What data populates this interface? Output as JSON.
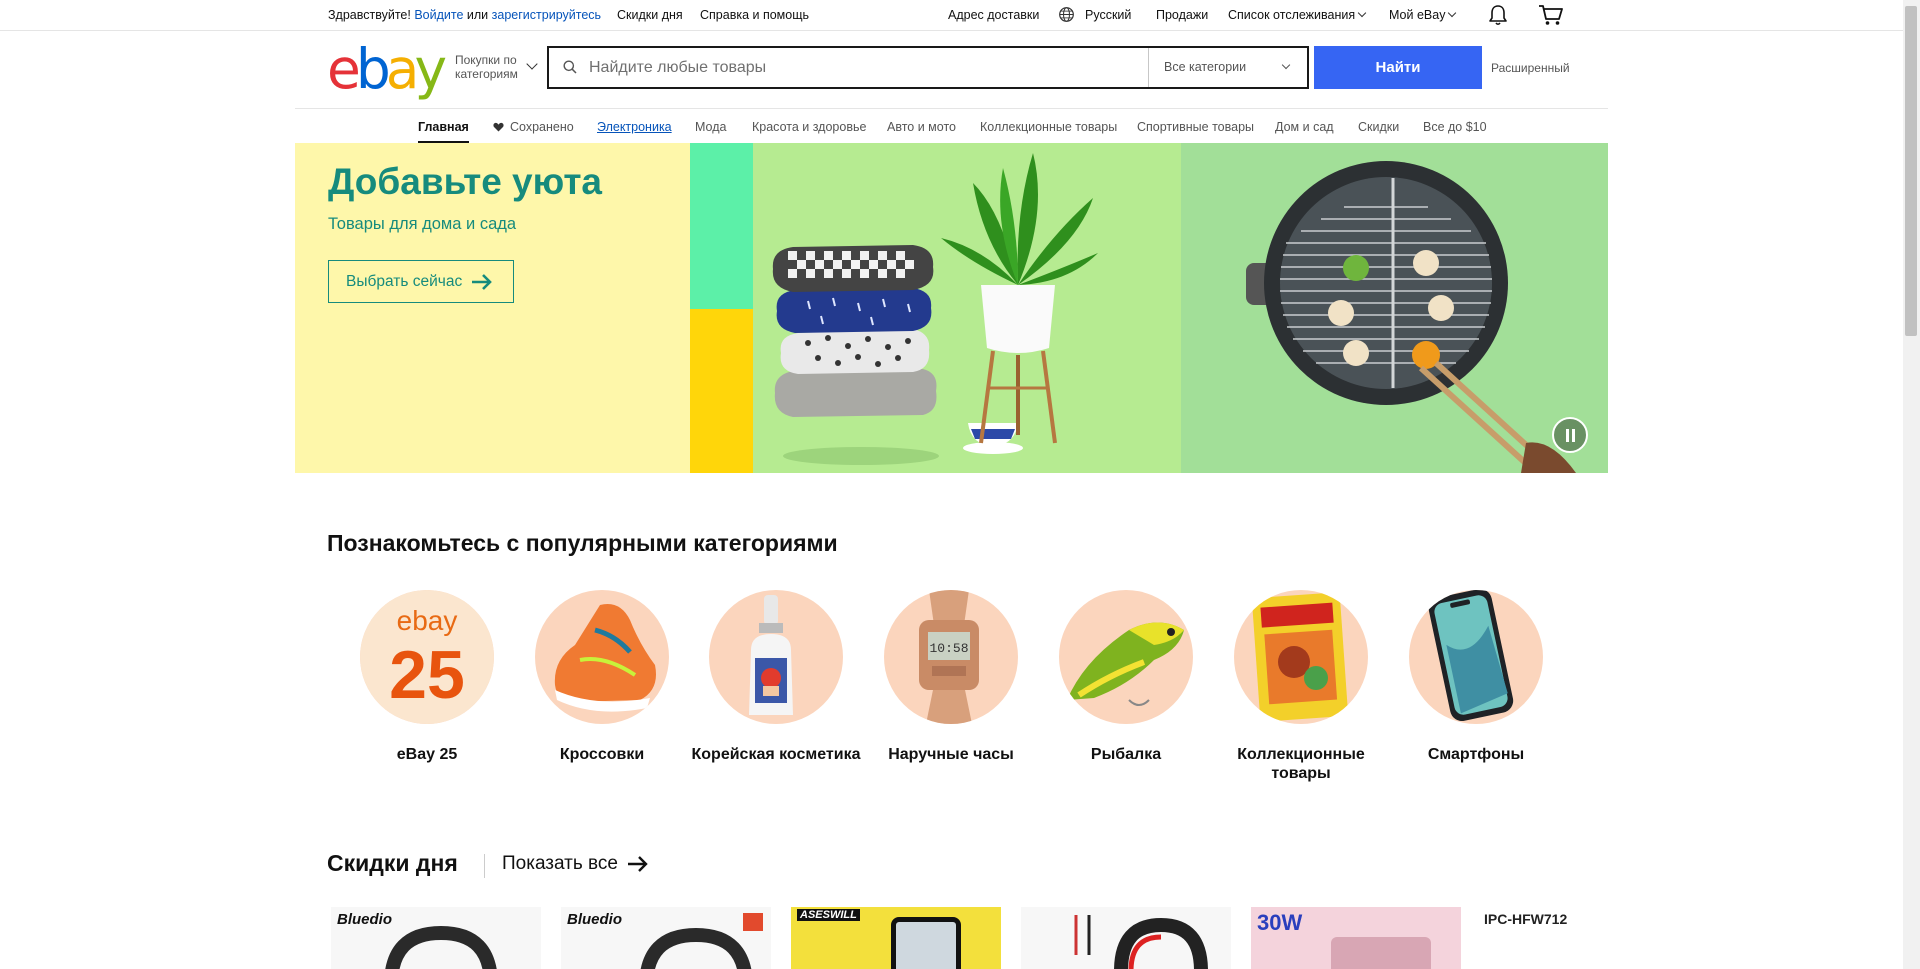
{
  "topbar": {
    "greeting": "Здравствуйте!",
    "signin": "Войдите",
    "or": "или",
    "register": "зарегистрируйтесь",
    "daily_deals": "Скидки дня",
    "help": "Справка и помощь",
    "ship_to": "Адрес доставки",
    "language": "Русский",
    "sell": "Продажи",
    "watchlist": "Список отслеживания",
    "my_ebay": "Мой eBay"
  },
  "header": {
    "logo_letters": [
      "e",
      "b",
      "a",
      "y"
    ],
    "shop_by_line1": "Покупки по",
    "shop_by_line2": "категориям",
    "search_placeholder": "Найдите любые товары",
    "category_select": "Все категории",
    "search_button": "Найти",
    "advanced": "Расширенный"
  },
  "nav": [
    {
      "label": "Главная"
    },
    {
      "label": "Сохранено"
    },
    {
      "label": "Электроника"
    },
    {
      "label": "Мода"
    },
    {
      "label": "Красота и здоровье"
    },
    {
      "label": "Авто и мото"
    },
    {
      "label": "Коллекционные товары"
    },
    {
      "label": "Спортивные товары"
    },
    {
      "label": "Дом и сад"
    },
    {
      "label": "Скидки"
    },
    {
      "label": "Все до $10"
    }
  ],
  "hero": {
    "title": "Добавьте уюта",
    "subtitle": "Товары для дома и сада",
    "button": "Выбрать сейчас"
  },
  "categories": {
    "title": "Познакомьтесь с популярными категориями",
    "items": [
      {
        "label": "eBay 25",
        "logo_text": "ebay",
        "number_text": "25",
        "icon": "ebay25-icon"
      },
      {
        "label": "Кроссовки",
        "icon": "sneaker-icon"
      },
      {
        "label": "Корейская косметика",
        "icon": "cosmetics-bottle-icon"
      },
      {
        "label": "Наручные часы",
        "icon": "watch-icon"
      },
      {
        "label": "Рыбалка",
        "icon": "fishing-lure-icon"
      },
      {
        "label": "Коллекционные товары",
        "icon": "comic-book-icon"
      },
      {
        "label": "Смартфоны",
        "icon": "smartphone-icon"
      }
    ]
  },
  "deals": {
    "title": "Скидки дня",
    "show_all": "Показать все",
    "items": [
      {
        "brand": "Bluedio"
      },
      {
        "brand": "Bluedio"
      },
      {
        "brand": "ASESWILL"
      },
      {
        "brand": ""
      },
      {
        "brand": "30W"
      },
      {
        "brand": "IPC-HFW712"
      }
    ]
  },
  "colors": {
    "accent": "#3665f3",
    "hero_text": "#168b7d",
    "hero_bg": "#fef7aa",
    "category_circle": "#fbd5bd"
  }
}
